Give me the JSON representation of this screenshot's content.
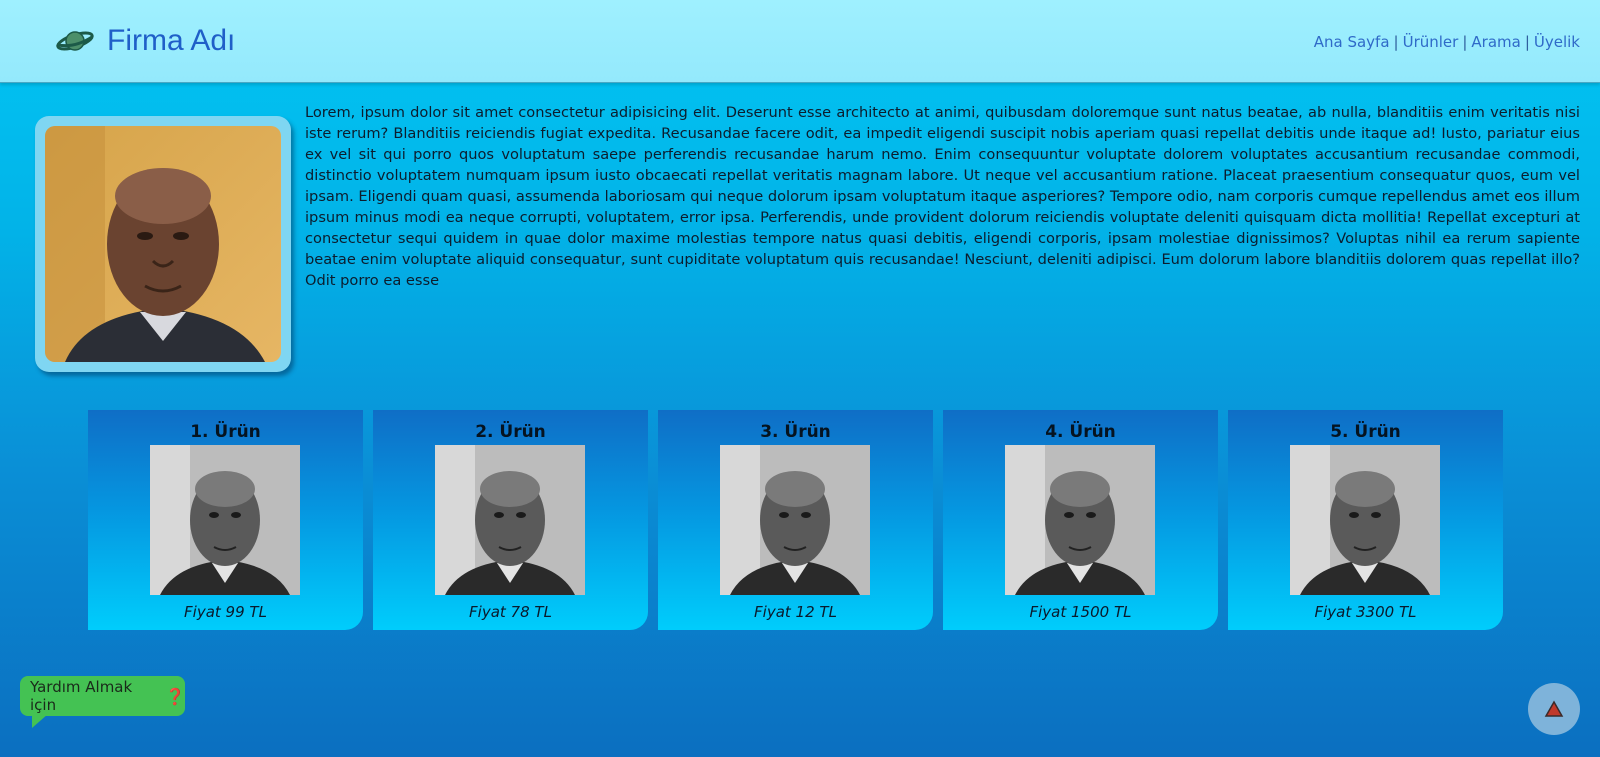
{
  "brand": {
    "name": "Firma Adı",
    "icon": "planet-icon"
  },
  "nav": {
    "items": [
      "Ana Sayfa",
      "Ürünler",
      "Arama",
      "Üyelik"
    ],
    "separator": "|"
  },
  "intro": {
    "text": "Lorem, ipsum dolor sit amet consectetur adipisicing elit. Deserunt esse architecto at animi, quibusdam doloremque sunt natus beatae, ab nulla, blanditiis enim veritatis nisi iste rerum? Blanditiis reiciendis fugiat expedita. Recusandae facere odit, ea impedit eligendi suscipit nobis aperiam quasi repellat debitis unde itaque ad! Iusto, pariatur eius ex vel sit qui porro quos voluptatum saepe perferendis recusandae harum nemo. Enim consequuntur voluptate dolorem voluptates accusantium recusandae commodi, distinctio voluptatem numquam ipsum iusto obcaecati repellat veritatis magnam labore. Ut neque vel accusantium ratione. Placeat praesentium consequatur quos, eum vel ipsam. Eligendi quam quasi, assumenda laboriosam qui neque dolorum ipsam voluptatum itaque asperiores? Tempore odio, nam corporis cumque repellendus amet eos illum ipsum minus modi ea neque corrupti, voluptatem, error ipsa. Perferendis, unde provident dolorum reiciendis voluptate deleniti quisquam dicta mollitia! Repellat excepturi at consectetur sequi quidem in quae dolor maxime molestias tempore natus quasi debitis, eligendi corporis, ipsam molestiae dignissimos? Voluptas nihil ea rerum sapiente beatae enim voluptate aliquid consequatur, sunt cupiditate voluptatum quis recusandae! Nesciunt, deleniti adipisci. Eum dolorum labore blanditiis dolorem quas repellat illo? Odit porro ea esse"
  },
  "products": [
    {
      "title": "1. Ürün",
      "price": "Fiyat 99 TL"
    },
    {
      "title": "2. Ürün",
      "price": "Fiyat 78 TL"
    },
    {
      "title": "3. Ürün",
      "price": "Fiyat 12 TL"
    },
    {
      "title": "4. Ürün",
      "price": "Fiyat 1500 TL"
    },
    {
      "title": "5. Ürün",
      "price": "Fiyat 3300 TL"
    }
  ],
  "help": {
    "label": "Yardım Almak için",
    "icon": "question-icon",
    "glyph": "❓"
  },
  "scroll_top": {
    "icon": "arrow-up-icon"
  },
  "colors": {
    "header_bg": "#9ff0ff",
    "brand_text": "#1f5fc8",
    "nav_link": "#2f6ac8",
    "help_bg": "#44c253",
    "top_button_bg": "#7eb3da"
  }
}
